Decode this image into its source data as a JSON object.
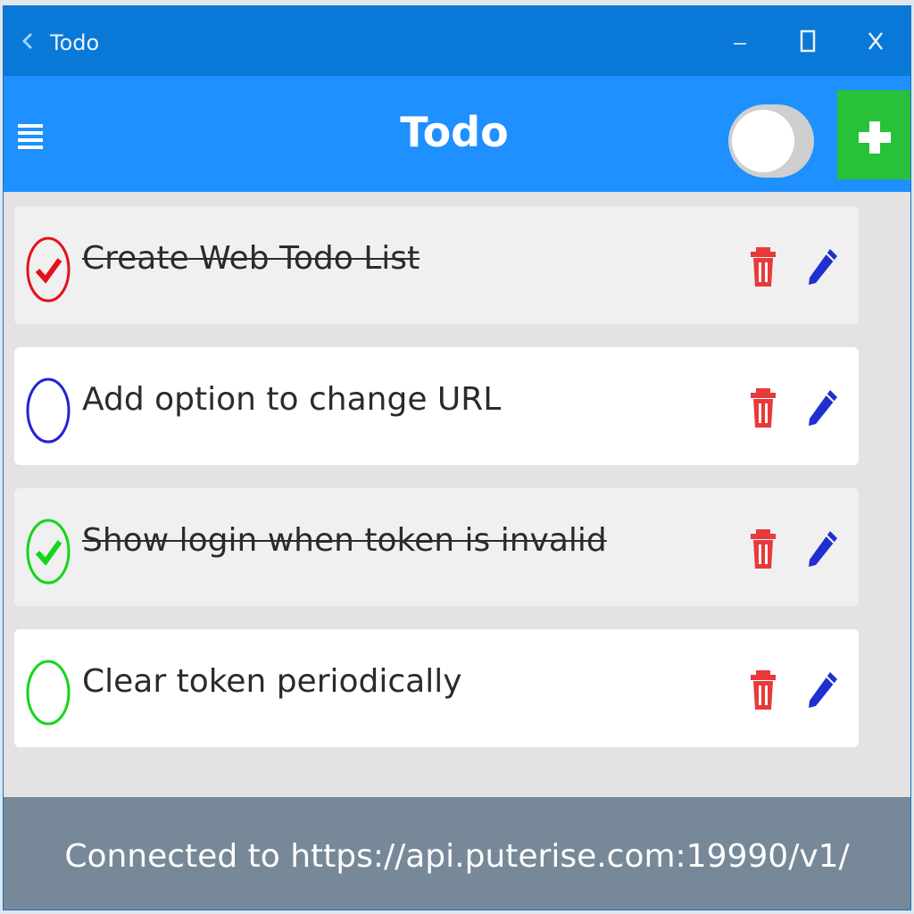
{
  "window": {
    "title": "Todo"
  },
  "header": {
    "title": "Todo",
    "toggle_on": false
  },
  "todos": [
    {
      "text": "Create Web Todo List",
      "done": true,
      "color": "#e2121d"
    },
    {
      "text": "Add option to change URL",
      "done": false,
      "color": "#2323d6"
    },
    {
      "text": "Show login when token is invalid",
      "done": true,
      "color": "#14d61a"
    },
    {
      "text": "Clear token periodically",
      "done": false,
      "color": "#14d61a"
    }
  ],
  "footer": {
    "status": "Connected to https://api.puterise.com:19990/v1/"
  },
  "colors": {
    "titlebar": "#0a78d7",
    "appbar": "#1e90ff",
    "add_button": "#27c23a",
    "delete_icon": "#e83a3a",
    "edit_icon": "#1f2fd0",
    "footer": "#778898"
  },
  "icons": {
    "window": "back-arrow-icon",
    "minimize": "minimize-icon",
    "maximize": "maximize-icon",
    "close": "close-icon",
    "menu": "hamburger-menu-icon",
    "add": "plus-icon",
    "delete": "trash-icon",
    "edit": "pencil-icon"
  }
}
